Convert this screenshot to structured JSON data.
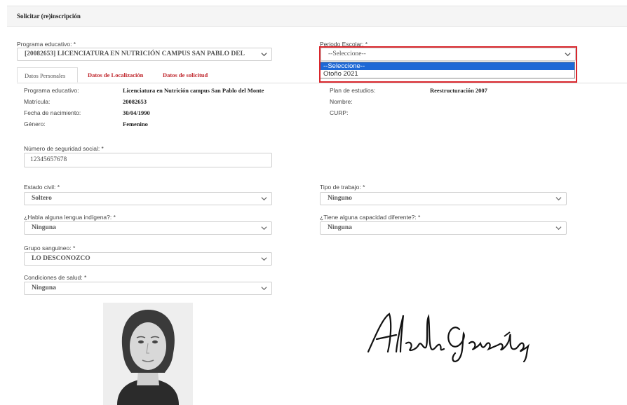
{
  "panel": {
    "title": "Solicitar (re)inscripción"
  },
  "programa": {
    "label": "Programa educativo: *",
    "selected": "[20082653] LICENCIATURA EN NUTRICIÓN CAMPUS SAN PABLO DEL"
  },
  "periodo": {
    "label": "Periodo Escolar: *",
    "selected": "--Seleccione--",
    "options": [
      "--Seleccione--",
      "Otoño 2021"
    ]
  },
  "tabs": [
    "Datos Personales",
    "Datos de Localización",
    "Datos de solicitud"
  ],
  "info": {
    "left": [
      {
        "label": "Programa educativo:",
        "value": "Licenciatura en Nutrición campus San Pablo del Monte"
      },
      {
        "label": "Matrícula:",
        "value": "20082653"
      },
      {
        "label": "Fecha de nacimiento:",
        "value": "30/04/1990"
      },
      {
        "label": "Género:",
        "value": "Femenino"
      }
    ],
    "right": [
      {
        "label": "Plan de estudios:",
        "value": "Reestructuración 2007"
      },
      {
        "label": "Nombre:",
        "value": ""
      },
      {
        "label": "CURP:",
        "value": ""
      }
    ]
  },
  "form": {
    "nss": {
      "label": "Número de seguridad social: *",
      "value": "12345657678"
    },
    "estado_civil": {
      "label": "Estado civil: *",
      "value": "Soltero"
    },
    "tipo_trabajo": {
      "label": "Tipo de trabajo: *",
      "value": "Ninguno"
    },
    "lengua": {
      "label": "¿Habla alguna lengua indígena?: *",
      "value": "Ninguna"
    },
    "capacidad": {
      "label": "¿Tiene alguna capacidad diferente?: *",
      "value": "Ninguna"
    },
    "grupo": {
      "label": "Grupo sanguineo: *",
      "value": "LO DESCONOZCO"
    },
    "salud": {
      "label": "Condiciones de salud: *",
      "value": "Ninguna"
    }
  },
  "signature": {
    "text": "Alfredo González"
  },
  "icons": {
    "select_arrow": "chevron-down-icon"
  },
  "colors": {
    "accent_red": "#c0272d",
    "highlight_blue": "#1e68d6"
  }
}
